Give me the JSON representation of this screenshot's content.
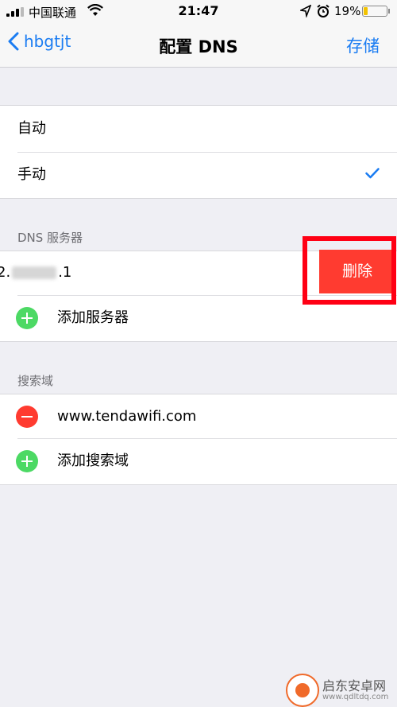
{
  "status_bar": {
    "carrier": "中国联通",
    "time": "21:47",
    "battery_text": "19%",
    "battery_level": 0.19
  },
  "nav": {
    "back_label": "hbgtjt",
    "title": "配置 DNS",
    "save_label": "存储"
  },
  "mode": {
    "items": [
      {
        "label": "自动",
        "checked": false
      },
      {
        "label": "手动",
        "checked": true
      }
    ]
  },
  "dns_section": {
    "header": "DNS 服务器",
    "server_prefix": "2.",
    "server_suffix": ".1",
    "delete_label": "删除",
    "add_label": "添加服务器"
  },
  "search_section": {
    "header": "搜索域",
    "domain": "www.tendawifi.com",
    "add_label": "添加搜索域"
  },
  "watermark": {
    "name": "启东安卓网",
    "url": "www.qdltdq.com"
  },
  "colors": {
    "accent": "#1a7cf2",
    "delete": "#ff3b30",
    "add": "#4cd964",
    "highlight": "#ff0014"
  }
}
